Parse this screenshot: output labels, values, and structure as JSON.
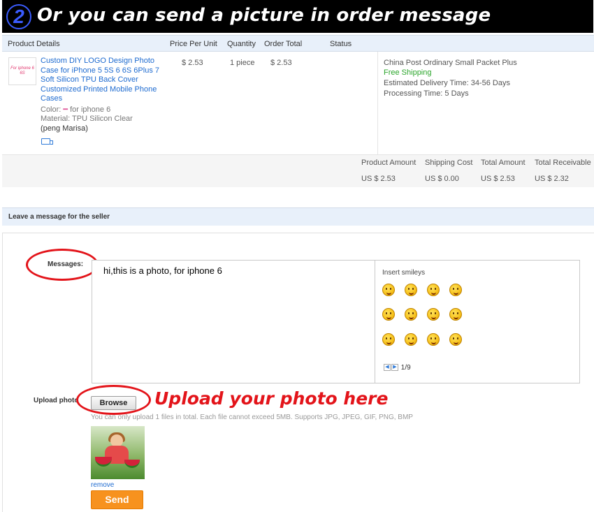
{
  "banner": {
    "number": "2",
    "text": "Or you can send a picture in order message"
  },
  "table": {
    "headers": {
      "product_details": "Product Details",
      "price_per_unit": "Price Per Unit",
      "quantity": "Quantity",
      "order_total": "Order Total",
      "status": "Status"
    }
  },
  "product": {
    "thumb_text": "For iphone 6 6S",
    "title": "Custom DIY LOGO Design Photo Case for iPhone 5 5S 6 6S 6Plus 7 Soft Silicon TPU Back Cover Customized Printed Mobile Phone Cases",
    "color_label": "Color:",
    "color_value": "for iphone 6",
    "material": "Material: TPU Silicon Clear",
    "buyer": "(peng Marisa)",
    "price": "$ 2.53",
    "quantity": "1 piece",
    "order_total": "$ 2.53"
  },
  "shipping": {
    "method": "China Post Ordinary Small Packet Plus",
    "free": "Free Shipping",
    "delivery": "Estimated Delivery Time: 34-56 Days",
    "processing": "Processing Time: 5 Days"
  },
  "totals": {
    "product_amount_label": "Product Amount",
    "product_amount": "US $ 2.53",
    "shipping_cost_label": "Shipping Cost",
    "shipping_cost": "US $ 0.00",
    "total_amount_label": "Total Amount",
    "total_amount": "US $ 2.53",
    "total_receivable_label": "Total Receivable",
    "total_receivable": "US $ 2.32"
  },
  "message": {
    "section_title": "Leave a message for the seller",
    "label": "Messages:",
    "text": "hi,this is a photo, for iphone 6",
    "smileys_title": "Insert smileys",
    "smileys": [
      "smiley-1",
      "smiley-2",
      "smiley-3",
      "smiley-4",
      "smiley-5",
      "smiley-6",
      "smiley-7",
      "smiley-8",
      "smiley-9",
      "smiley-10",
      "smiley-11",
      "smiley-12"
    ],
    "pager": "1/9"
  },
  "upload": {
    "label": "Upload photo",
    "browse": "Browse",
    "callout": "Upload your photo here",
    "note": "You can only upload 1 files in total. Each file cannot exceed 5MB. Supports JPG, JPEG, GIF, PNG, BMP",
    "remove": "remove",
    "send": "Send"
  },
  "colors": {
    "accent_link": "#1e6bd0",
    "highlight_red": "#e3141a",
    "send_orange": "#f7921e",
    "free_green": "#2aa52a",
    "header_bg": "#e8f0fa"
  }
}
